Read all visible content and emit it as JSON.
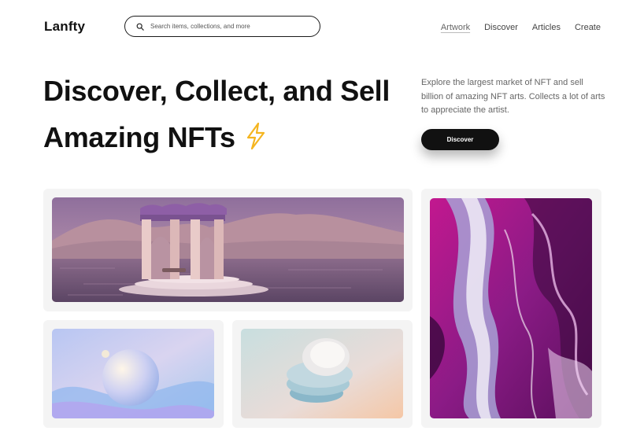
{
  "header": {
    "logo": "Lanfty",
    "search_placeholder": "Search items, collections, and more",
    "nav": [
      "Artwork",
      "Discover",
      "Articles",
      "Create"
    ],
    "active_nav": "Artwork"
  },
  "hero": {
    "title_line1": "Discover, Collect, and Sell",
    "title_line2": "Amazing NFTs",
    "description": "Explore the largest market of NFT and sell billion of amazing NFT arts. Collects a lot of arts to appreciate the artist.",
    "cta_label": "Discover"
  },
  "colors": {
    "accent_bolt": "#f5b51f",
    "button_bg": "#111111",
    "card_bg": "#f4f4f4"
  },
  "icons": [
    "search-icon",
    "lightning-icon"
  ]
}
